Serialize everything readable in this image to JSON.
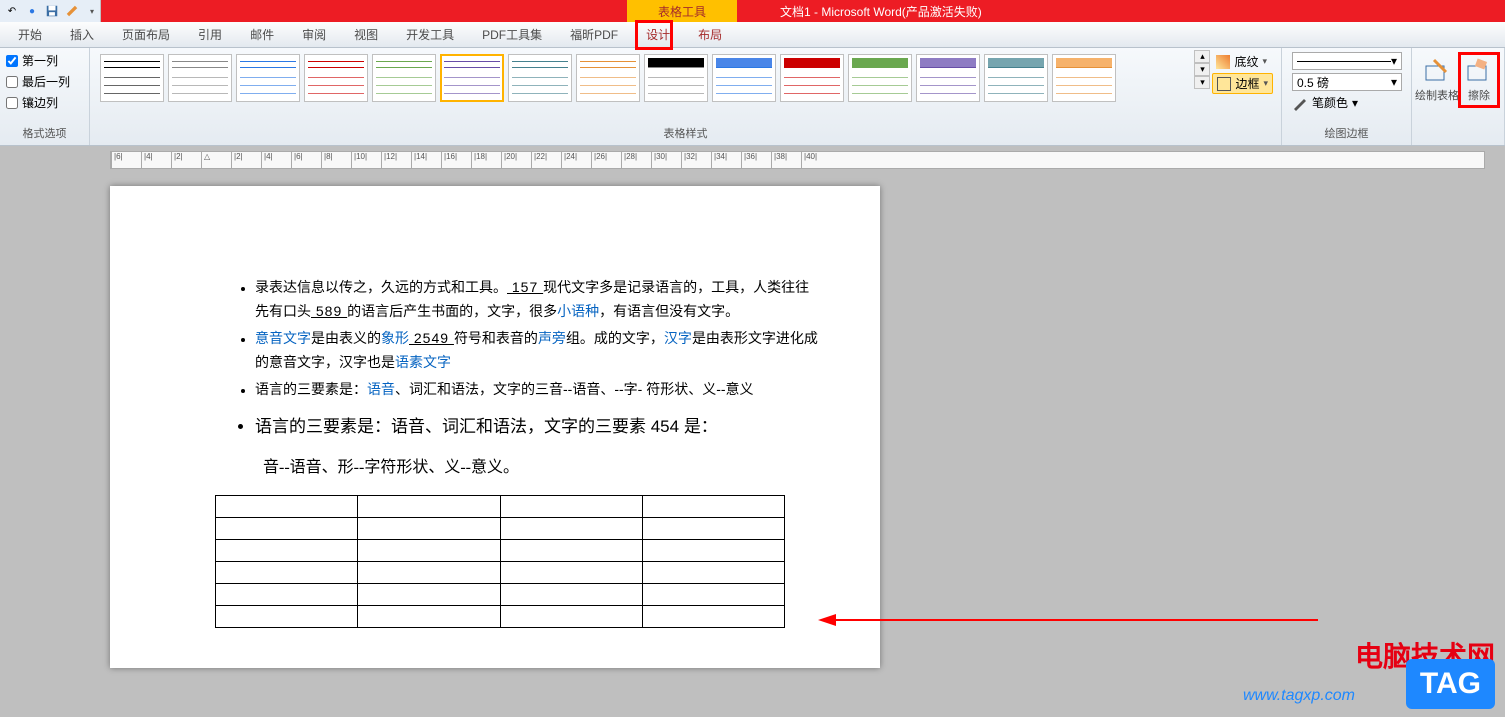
{
  "title": {
    "context_tab": "表格工具",
    "window_title": "文档1 - Microsoft Word(产品激活失败)"
  },
  "qat": {
    "undo": "↶",
    "sep": "•",
    "save": "💾",
    "redo": "↷"
  },
  "tabs": {
    "start": "开始",
    "insert": "插入",
    "layout": "页面布局",
    "ref": "引用",
    "mail": "邮件",
    "review": "审阅",
    "view": "视图",
    "dev": "开发工具",
    "pdf1": "PDF工具集",
    "pdf2": "福昕PDF",
    "design": "设计",
    "tlayout": "布局"
  },
  "checks": {
    "c1": "第一列",
    "c2": "最后一列",
    "c3": "镶边列"
  },
  "groups": {
    "style_opts": "格式选项",
    "table_styles": "表格样式",
    "draw_borders": "绘图边框"
  },
  "shade": {
    "shading": "底纹",
    "borders": "边框",
    "weight": "0.5 磅",
    "pen_color": "笔颜色"
  },
  "big_buttons": {
    "draw": "绘制表格",
    "erase": "擦除"
  },
  "document": {
    "b1_a": "录表达信息以传之，久远的方式和工具。",
    "b1_n1": " 157 ",
    "b1_b": "现代文字多是记录语言的，工具，人类往往先有口头",
    "b1_n2": " 589 ",
    "b1_c": "的语言后产生书面的，文字，很多",
    "b1_link1": "小语种",
    "b1_d": "，有语言但没有文字。",
    "b2_a": "意音文字",
    "b2_b": "是由表义的",
    "b2_c": "象形",
    "b2_n": " 2549 ",
    "b2_d": "符号和表音的",
    "b2_e": "声旁",
    "b2_f": "组。成的文字，",
    "b2_g": "汉字",
    "b2_h": "是由表形文字进化成的意音文字，汉字也是",
    "b2_i": "语素文字",
    "b3_a": "语言的三要素是：",
    "b3_b": "语音",
    "b3_c": "、词汇和语法，文字的三音--语音、--字- 符形状、义--意义",
    "big_a": "语言的三要素是：语音、词汇和语法，文字的三要素",
    "big_n": " 454 ",
    "big_b": "是：",
    "final": "音--语音、形--字符形状、义--意义。"
  },
  "watermark": {
    "site_cn": "电脑技术网",
    "tag": "TAG",
    "url": "www.tagxp.com"
  }
}
